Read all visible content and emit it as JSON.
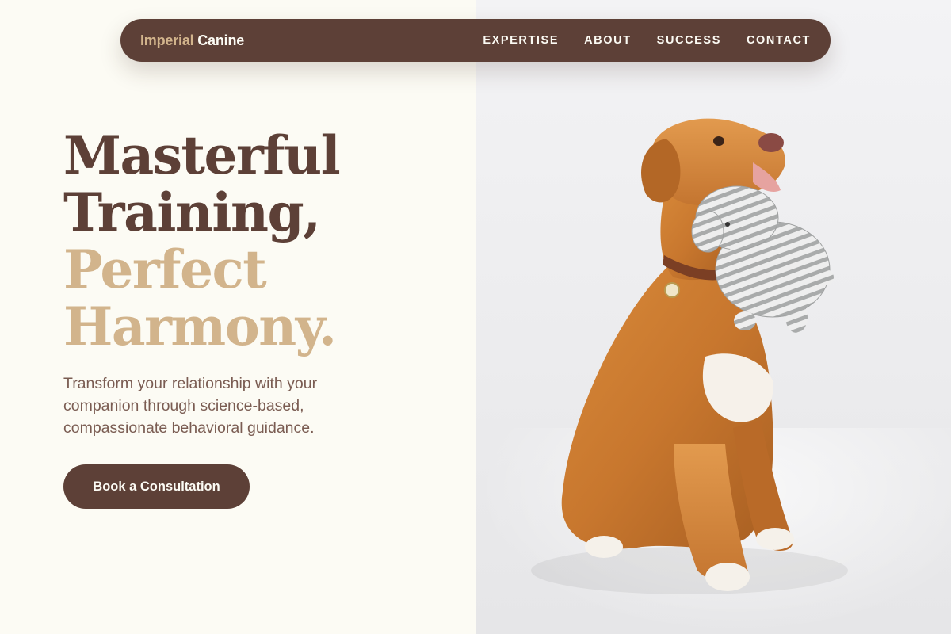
{
  "brand": {
    "part1": "Imperial",
    "part2": "Canine"
  },
  "nav": {
    "items": [
      "EXPERTISE",
      "ABOUT",
      "SUCCESS",
      "CONTACT"
    ]
  },
  "hero": {
    "title_line1": "Masterful",
    "title_line2": "Training,",
    "title_line3": "Perfect",
    "title_line4": "Harmony.",
    "subtitle": "Transform your relationship with your companion through science-based, compassionate behavioral guidance.",
    "cta_label": "Book a Consultation"
  },
  "image": {
    "subject": "dog-with-toy"
  },
  "colors": {
    "brown": "#5d4037",
    "tan": "#d2b48c",
    "cream": "#fcfbf4",
    "text": "#7a5c52"
  }
}
